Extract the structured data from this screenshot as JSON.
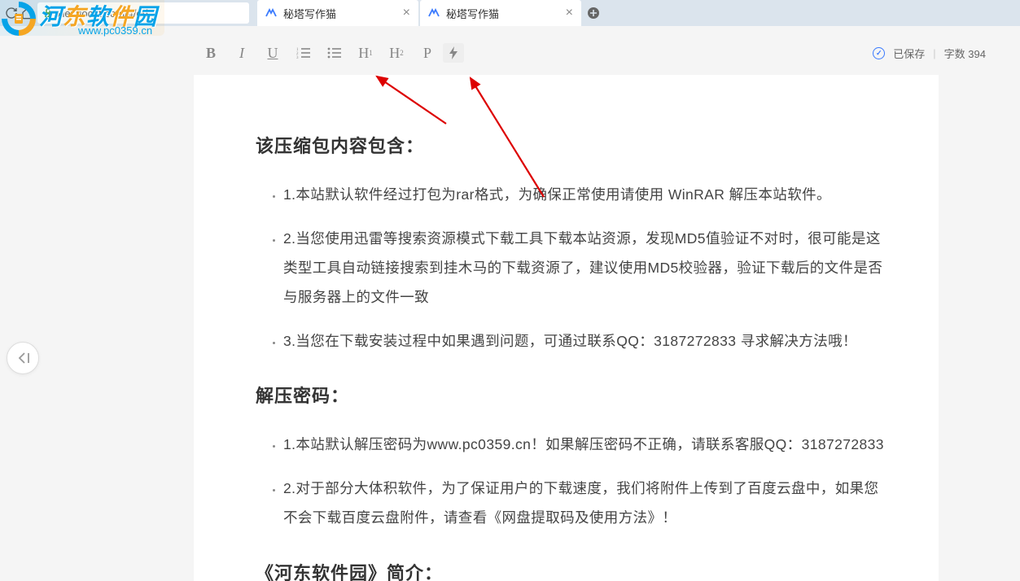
{
  "browser": {
    "url": "xiezuocat.com/#/ed",
    "tabs": [
      {
        "title": "秘塔写作猫"
      },
      {
        "title": "秘塔写作猫"
      }
    ]
  },
  "toolbar": {
    "bold": "B",
    "italic": "I",
    "underline": "U",
    "h1_label": "H",
    "h1_sub": "1",
    "h2_label": "H",
    "h2_sub": "2",
    "para": "P"
  },
  "status": {
    "saved": "已保存",
    "wordcount_label": "字数",
    "wordcount_value": "394"
  },
  "document": {
    "heading1": "该压缩包内容包含：",
    "list1": [
      "1.本站默认软件经过打包为rar格式，为确保正常使用请使用 WinRAR 解压本站软件。",
      "2.当您使用迅雷等搜索资源模式下载工具下载本站资源，发现MD5值验证不对时，很可能是这类型工具自动链接搜索到挂木马的下载资源了，建议使用MD5校验器，验证下载后的文件是否与服务器上的文件一致",
      "3.当您在下载安装过程中如果遇到问题，可通过联系QQ：3187272833 寻求解决方法哦！"
    ],
    "heading2": "解压密码：",
    "list2": [
      "1.本站默认解压密码为www.pc0359.cn！如果解压密码不正确，请联系客服QQ：3187272833",
      "2.对于部分大体积软件，为了保证用户的下载速度，我们将附件上传到了百度云盘中，如果您不会下载百度云盘附件，请查看《网盘提取码及使用方法》！"
    ],
    "heading3": "《河东软件园》简介："
  },
  "watermark": {
    "text_chars": [
      "河",
      "东",
      "软",
      "件",
      "园"
    ],
    "url": "www.pc0359.cn"
  }
}
